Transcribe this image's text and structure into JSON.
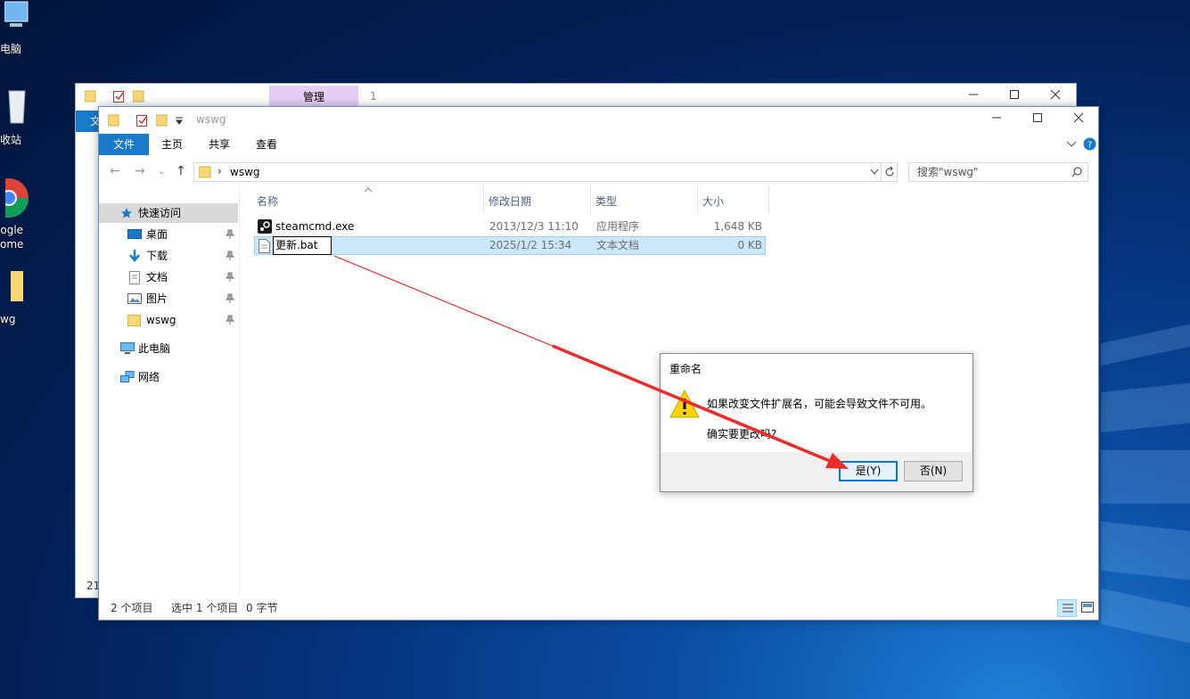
{
  "desktop": {
    "icons": [
      {
        "label": "电脑",
        "icon": "computer-icon"
      },
      {
        "label": "收站",
        "icon": "recycle-bin-icon"
      },
      {
        "label": "ogle\nome",
        "icon": "chrome-icon"
      },
      {
        "label": "wg",
        "icon": "folder-icon"
      }
    ]
  },
  "back_window": {
    "manage_tab": "管理",
    "tab_number": "1",
    "ribbon_file_partial": "文",
    "status_partial": "21"
  },
  "window": {
    "title": "wswg",
    "ribbon_tabs": [
      "文件",
      "主页",
      "共享",
      "查看"
    ],
    "address_path": "wswg",
    "search_placeholder": "搜索\"wswg\"",
    "sidebar": {
      "quick_access": "快速访问",
      "items": [
        {
          "label": "桌面",
          "icon": "desktop-icon",
          "pinned": true
        },
        {
          "label": "下载",
          "icon": "download-icon",
          "pinned": true
        },
        {
          "label": "文档",
          "icon": "document-icon",
          "pinned": true
        },
        {
          "label": "图片",
          "icon": "picture-icon",
          "pinned": true
        },
        {
          "label": "wswg",
          "icon": "folder-icon",
          "pinned": true
        }
      ],
      "this_pc": "此电脑",
      "network": "网络"
    },
    "columns": [
      "名称",
      "修改日期",
      "类型",
      "大小"
    ],
    "files": [
      {
        "name": "steamcmd.exe",
        "date": "2013/12/3 11:10",
        "type": "应用程序",
        "size": "1,648 KB",
        "icon": "steam-icon",
        "selected": false
      },
      {
        "name": "更新.bat",
        "date": "2025/1/2 15:34",
        "type": "文本文档",
        "size": "0 KB",
        "icon": "text-file-icon",
        "selected": true,
        "editing": true
      }
    ],
    "status": {
      "count": "2 个项目",
      "selected": "选中 1 个项目",
      "size": "0 字节"
    }
  },
  "dialog": {
    "title": "重命名",
    "message": "如果改变文件扩展名，可能会导致文件不可用。",
    "question": "确实要更改吗?",
    "yes_label": "是(Y)",
    "no_label": "否(N)"
  },
  "annotation": {
    "color": "#ee2b2b"
  },
  "colors": {
    "accent": "#1979ca",
    "selection": "#cce8ff",
    "manage_tab": "#e6cff5"
  }
}
